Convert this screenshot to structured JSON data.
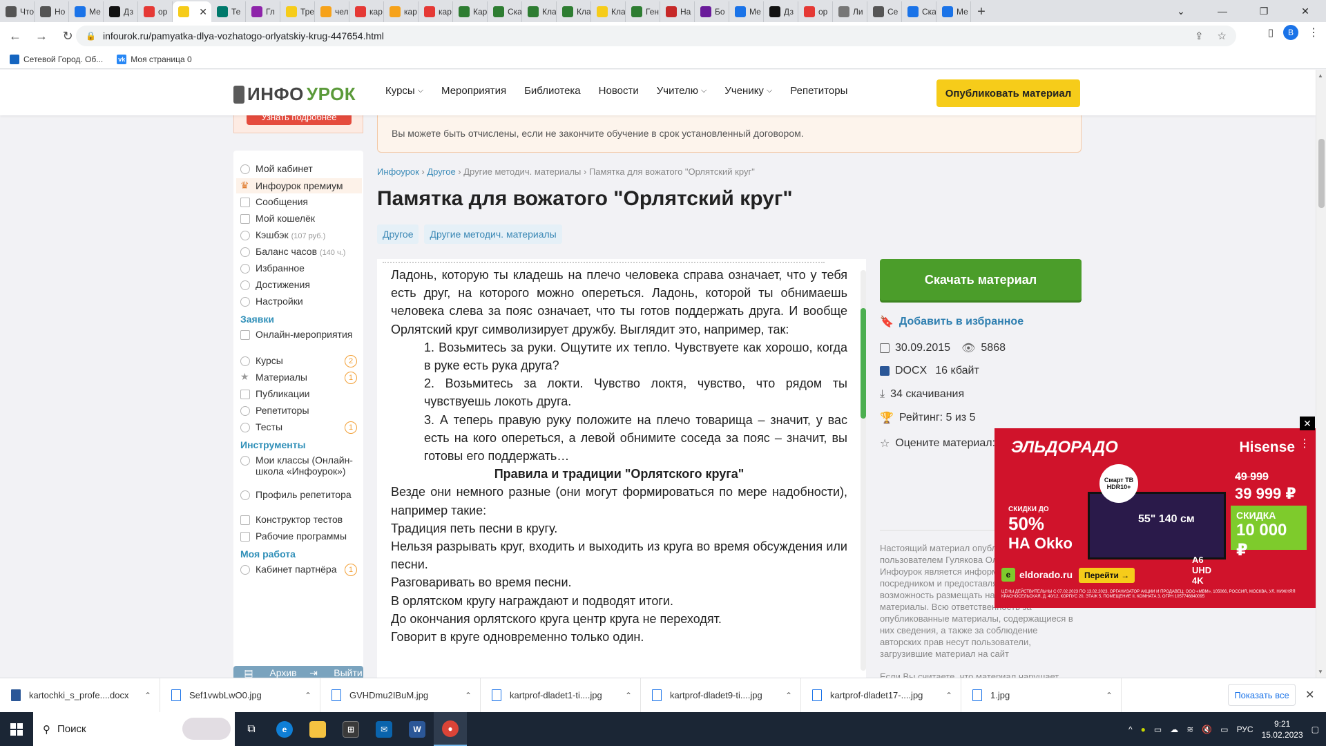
{
  "browser": {
    "tabs": [
      {
        "label": "Что",
        "color": "#555"
      },
      {
        "label": "Но",
        "color": "#555"
      },
      {
        "label": "Ме",
        "color": "#1a73e8"
      },
      {
        "label": "Дз",
        "color": "#111"
      },
      {
        "label": "ор",
        "color": "#e53935"
      },
      {
        "label": "",
        "color": "#f6cc1a",
        "active": true
      },
      {
        "label": "Те",
        "color": "#00796b"
      },
      {
        "label": "Гл",
        "color": "#8e24aa"
      },
      {
        "label": "Тре",
        "color": "#f6cc1a"
      },
      {
        "label": "чел",
        "color": "#f6a21a"
      },
      {
        "label": "кар",
        "color": "#e53935"
      },
      {
        "label": "кар",
        "color": "#f6a21a"
      },
      {
        "label": "кар",
        "color": "#e53935"
      },
      {
        "label": "Кар",
        "color": "#2e7d32"
      },
      {
        "label": "Ска",
        "color": "#2e7d32"
      },
      {
        "label": "Кла",
        "color": "#2e7d32"
      },
      {
        "label": "Кла",
        "color": "#2e7d32"
      },
      {
        "label": "Кла",
        "color": "#f6cc1a"
      },
      {
        "label": "Ген",
        "color": "#2e7d32"
      },
      {
        "label": "На",
        "color": "#c62828"
      },
      {
        "label": "Бо",
        "color": "#6a1b9a"
      },
      {
        "label": "Ме",
        "color": "#1a73e8"
      },
      {
        "label": "Дз",
        "color": "#111"
      },
      {
        "label": "ор",
        "color": "#e53935"
      },
      {
        "label": "Ли",
        "color": "#777"
      },
      {
        "label": "Се",
        "color": "#555"
      },
      {
        "label": "Ска",
        "color": "#1a73e8"
      },
      {
        "label": "Ме",
        "color": "#1a73e8"
      }
    ],
    "active_tab_close": "✕",
    "new_tab": "+",
    "url": "infourok.ru/pamyatka-dlya-vozhatogo-orlyatskiy-krug-447654.html",
    "profile_initial": "В",
    "bookmarks": [
      {
        "label": "Сетевой Город. Об...",
        "color": "#1565c0"
      },
      {
        "label": "Моя страница 0",
        "color": "#2787f5",
        "glyph": "vk"
      }
    ]
  },
  "site": {
    "logo_main": "ИНФО",
    "logo_accent": "УРОК",
    "nav": [
      {
        "label": "Курсы",
        "dropdown": true
      },
      {
        "label": "Мероприятия",
        "dropdown": false
      },
      {
        "label": "Библиотека",
        "dropdown": false
      },
      {
        "label": "Новости",
        "dropdown": false
      },
      {
        "label": "Учителю",
        "dropdown": true
      },
      {
        "label": "Ученику",
        "dropdown": true
      },
      {
        "label": "Репетиторы",
        "dropdown": false
      }
    ],
    "publish_button": "Опубликовать материал",
    "promo_button": "Узнать подробнее"
  },
  "sidebar": {
    "items": [
      {
        "label": "Мой кабинет"
      },
      {
        "label": "Инфоурок премиум",
        "active": true
      },
      {
        "label": "Сообщения"
      },
      {
        "label": "Мой кошелёк"
      },
      {
        "label": "Кэшбэк",
        "muted": "(107 руб.)"
      },
      {
        "label": "Баланс часов",
        "muted": "(140 ч.)"
      },
      {
        "label": "Избранное"
      },
      {
        "label": "Достижения"
      },
      {
        "label": "Настройки"
      }
    ],
    "section_requests": "Заявки",
    "requests": [
      {
        "label": "Онлайн-мероприятия"
      },
      {
        "label": "Курсы",
        "badge": "2"
      },
      {
        "label": "Материалы",
        "badge": "1"
      },
      {
        "label": "Публикации"
      },
      {
        "label": "Репетиторы"
      },
      {
        "label": "Тесты",
        "badge": "1"
      }
    ],
    "section_tools": "Инструменты",
    "tools": [
      {
        "label": "Мои классы (Онлайн-школа «Инфоурок»)"
      },
      {
        "label": "Профиль репетитора"
      },
      {
        "label": "Конструктор тестов"
      },
      {
        "label": "Рабочие программы"
      }
    ],
    "section_work": "Моя работа",
    "work": [
      {
        "label": "Кабинет партнёра",
        "badge": "1"
      }
    ],
    "archive": "Архив",
    "logout": "Выйти"
  },
  "main": {
    "alert": "Вы можете быть отчислены, если не закончите обучение в срок установленный договором.",
    "breadcrumbs": [
      "Инфоурок",
      "Другое",
      "Другие методич. материалы",
      "Памятка для вожатого \"Орлятский круг\""
    ],
    "breadcrumb_sep": " › ",
    "title": "Памятка для вожатого \"Орлятский круг\"",
    "tags": [
      "Другое",
      "Другие методич. материалы"
    ],
    "doc": {
      "p1": "Ладонь,  которую ты кладешь на плечо человека справа означает, что у тебя есть друг, на которого можно опереться.  Ладонь, которой ты обнимаешь человека слева за пояс означает, что ты готов поддержать друга.  И вообще Орлятский круг символизирует дружбу. Выглядит это, например, так:",
      "li1": "1.   Возьмитесь за руки. Ощутите их тепло. Чувствуете как хорошо, когда в руке есть рука друга?",
      "li2": "2.     Возьмитесь за локти. Чувство локтя, чувство, что рядом ты чувствуешь локоть друга.",
      "li3": "3.   А теперь правую руку положите на плечо товарища – значит, у вас есть на кого опереться, а левой обнимите соседа за пояс – значит, вы готовы его поддержать…",
      "heading": "Правила и традиции \"Орлятского круга\"",
      "p2": "Везде они немного разные (они могут формироваться по мере надобности), например такие:",
      "r1": "Традиция петь песни в кругу.",
      "r2": "Нельзя разрывать круг, входить и выходить из круга во время обсуждения или песни.",
      "r3": "Разговаривать во время песни.",
      "r4": "В орлятском кругу награждают и подводят итоги.",
      "r5": "До окончания орлятского круга центр круга не переходят.",
      "r6": "Говорит в круге одновременно только один."
    }
  },
  "aside": {
    "download": "Скачать материал",
    "favorite": "Добавить в избранное",
    "date": "30.09.2015",
    "views": "5868",
    "format": "DOCX",
    "size": "16 кбайт",
    "downloads": "34 скачивания",
    "rating": "Рейтинг: 5 из 5",
    "rate_label": "Оцените материал:",
    "stars": "★★★★★",
    "description": "Настоящий материал опубликован пользователем Гулякова Ольга Владимировна. Инфоурок является информационным посредником и предоставляет пользователям возможность размещать на сайте методические материалы. Всю ответственность за опубликованные материалы, содержащиеся в них сведения, а также за соблюдение авторских прав несут пользователи, загрузившие материал на сайт",
    "description2": "Если Вы считаете, что материал нарушает авторские права либо по каким-то другим причинам должен быть удален с сайта, Вы можете оставить жалобу на материал."
  },
  "ad": {
    "brand": "ЭЛЬДОРАДО",
    "partner": "Hisense",
    "smart_line1": "Смарт ТВ",
    "smart_line2": "HDR10+",
    "okko_small": "СКИДКИ ДО",
    "okko_percent": "50%",
    "okko_brand": "НА Okko",
    "tv_size": "55\" 140 см",
    "tv_model": "A6 UHD 4K",
    "old_price": "49 999",
    "price": "39 999 ₽",
    "discount_label": "СКИДКА",
    "discount_value": "10 000 ₽",
    "site": "eldorado.ru",
    "cta": "Перейти →",
    "fine": "ЦЕНЫ ДЕЙСТВИТЕЛЬНЫ С 07.02.2023 ПО 13.02.2023. ОРГАНИЗАТОР АКЦИИ И ПРОДАВЕЦ: ООО «МВМ», 105066, РОССИЯ, МОСКВА, УЛ. НИЖНЯЯ КРАСНОСЕЛЬСКАЯ, Д. 40/12, КОРПУС 20, ЭТАЖ 5, ПОМЕЩЕНИЕ II, КОМНАТА 3. ОГРН 1057746840095",
    "close": "✕"
  },
  "downloads": {
    "items": [
      {
        "label": "kartochki_s_profe....docx",
        "word": true
      },
      {
        "label": "Sef1vwbLwO0.jpg"
      },
      {
        "label": "GVHDmu2IBuM.jpg"
      },
      {
        "label": "kartprof-dladet1-ti....jpg"
      },
      {
        "label": "kartprof-dladet9-ti....jpg"
      },
      {
        "label": "kartprof-dladet17-....jpg"
      },
      {
        "label": "1.jpg"
      }
    ],
    "show_all": "Показать все"
  },
  "taskbar": {
    "search": "Поиск",
    "lang": "РУС",
    "time": "9:21",
    "date": "15.02.2023"
  }
}
